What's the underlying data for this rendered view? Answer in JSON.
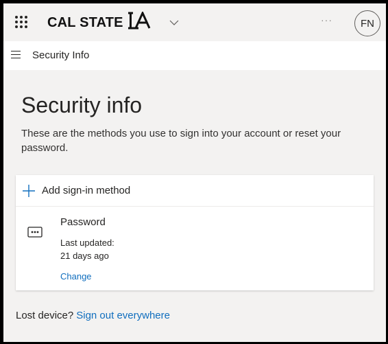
{
  "header": {
    "brand": "CAL STATE",
    "brand_mark": "LA",
    "more_label": "···",
    "avatar_initials": "FN"
  },
  "nav": {
    "title": "Security Info"
  },
  "main": {
    "title": "Security info",
    "description": "These are the methods you use to sign into your account or reset your password."
  },
  "card": {
    "add_label": "Add sign-in method",
    "method": {
      "name": "Password",
      "updated_label": "Last updated:",
      "updated_value": "21 days ago",
      "change_label": "Change"
    }
  },
  "footer": {
    "lost_label": "Lost device?",
    "signout_label": "Sign out everywhere"
  },
  "colors": {
    "accent": "#106ebe",
    "background": "#f3f2f1",
    "card": "#ffffff",
    "text": "#252423"
  },
  "icons": [
    "waffle-icon",
    "chevron-down-icon",
    "more-icon",
    "hamburger-icon",
    "plus-icon",
    "password-icon"
  ]
}
